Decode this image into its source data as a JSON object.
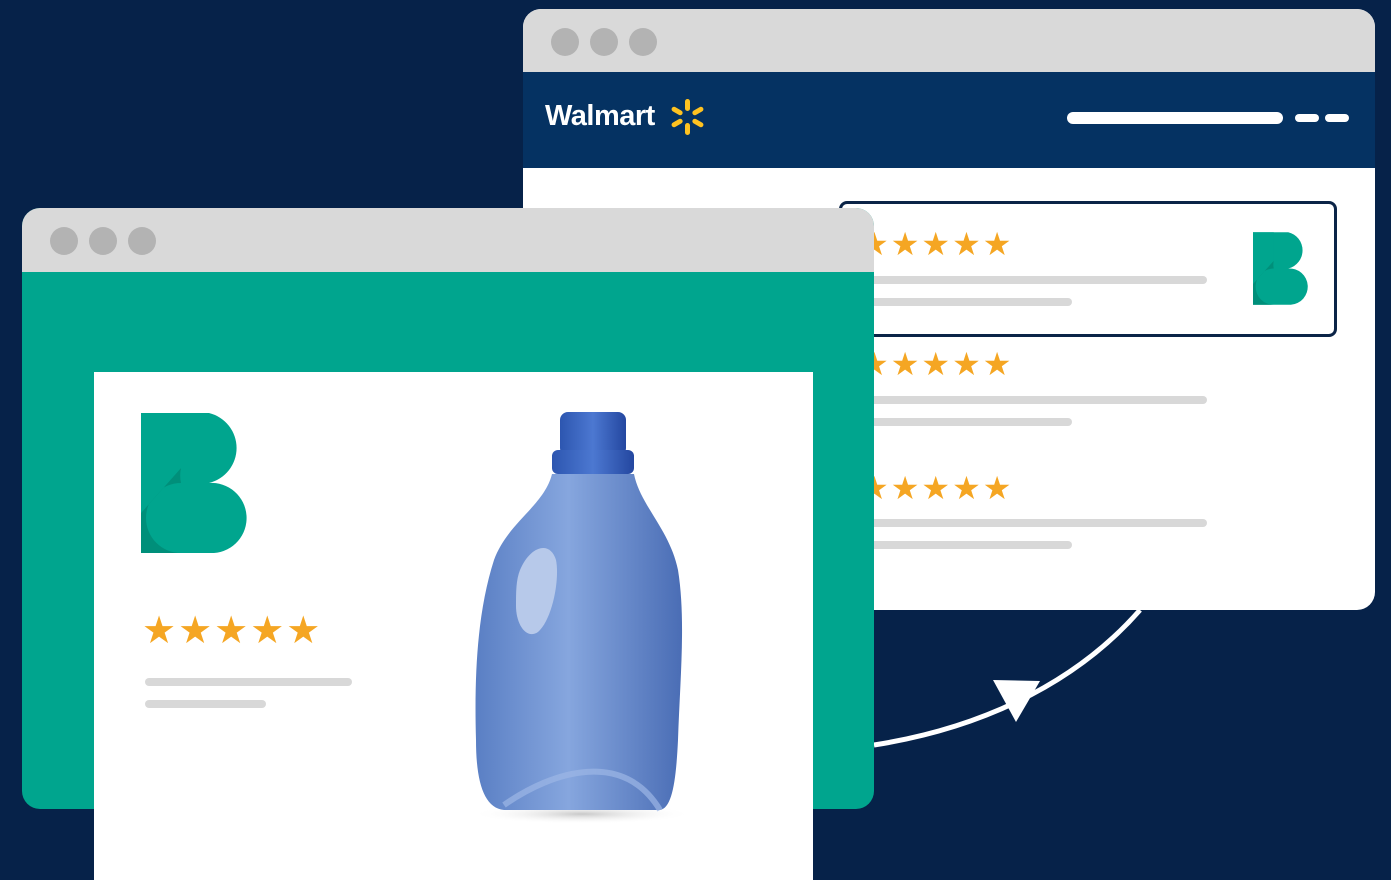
{
  "walmart_window": {
    "brand_name": "Walmart",
    "spark_color": "#ffc220",
    "header_color": "#053262",
    "reviews": [
      {
        "rating": 5,
        "stars": "★★★★★",
        "highlighted": true,
        "syndicated_badge": "bazaarvoice-logo-icon"
      },
      {
        "rating": 5,
        "stars": "★★★★★",
        "highlighted": false
      },
      {
        "rating": 5,
        "stars": "★★★★★",
        "highlighted": false
      }
    ]
  },
  "brand_window": {
    "accent_color": "#00a58e",
    "logo_icon": "bazaarvoice-logo-icon",
    "review": {
      "rating": 5,
      "stars": "★★★★★"
    },
    "product_image": "detergent-bottle-image"
  },
  "colors": {
    "background": "#062249",
    "star": "#f5a623",
    "titlebar": "#d9d9d9"
  }
}
